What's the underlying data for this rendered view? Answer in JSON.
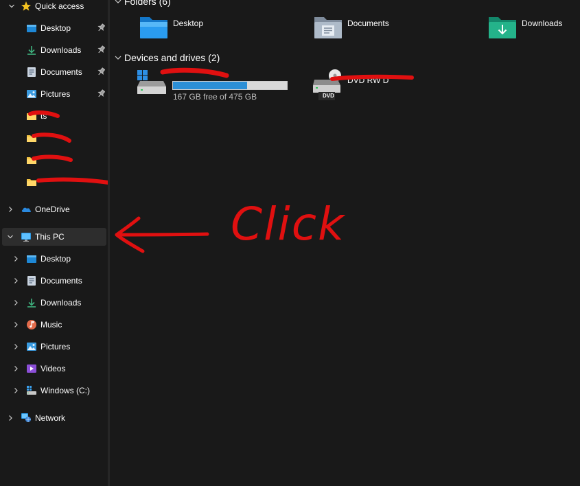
{
  "nav": {
    "quick_access_label": "Quick access",
    "quick_items": [
      {
        "label": "Desktop",
        "icon": "desktop-folder-icon",
        "pinned": true
      },
      {
        "label": "Downloads",
        "icon": "downloads-icon",
        "pinned": true
      },
      {
        "label": "Documents",
        "icon": "documents-icon",
        "pinned": true
      },
      {
        "label": "Pictures",
        "icon": "pictures-icon",
        "pinned": true
      },
      {
        "label": "ts",
        "icon": "folder-icon",
        "pinned": false
      },
      {
        "label": "",
        "icon": "folder-icon",
        "pinned": false
      },
      {
        "label": "",
        "icon": "folder-icon",
        "pinned": false
      },
      {
        "label": "",
        "icon": "folder-icon",
        "pinned": false
      }
    ],
    "onedrive_label": "OneDrive",
    "this_pc_label": "This PC",
    "this_pc_items": [
      {
        "label": "Desktop",
        "icon": "desktop-folder-icon"
      },
      {
        "label": "Documents",
        "icon": "documents-icon"
      },
      {
        "label": "Downloads",
        "icon": "downloads-icon"
      },
      {
        "label": "Music",
        "icon": "music-icon"
      },
      {
        "label": "Pictures",
        "icon": "pictures-icon"
      },
      {
        "label": "Videos",
        "icon": "videos-icon"
      },
      {
        "label": "Windows  (C:)",
        "icon": "windows-drive-icon"
      }
    ],
    "network_label": "Network"
  },
  "main": {
    "folders_header": "Folders (6)",
    "folders": [
      {
        "label": "Desktop",
        "icon": "desktop-folder-icon"
      },
      {
        "label": "Documents",
        "icon": "documents-folder-icon"
      },
      {
        "label": "Downloads",
        "icon": "downloads-folder-icon"
      }
    ],
    "devices_header": "Devices and drives (2)",
    "drive_c": {
      "free_text": "167 GB free of 475 GB",
      "used_fraction": 0.65
    },
    "dvd": {
      "badge": "DVD",
      "label": "DVD RW D"
    }
  },
  "annotation": {
    "text": "Click"
  },
  "colors": {
    "background": "#191919",
    "selected": "#2d2d2d",
    "accent_blue": "#2c8fd6",
    "annotation_red": "#e01010"
  }
}
